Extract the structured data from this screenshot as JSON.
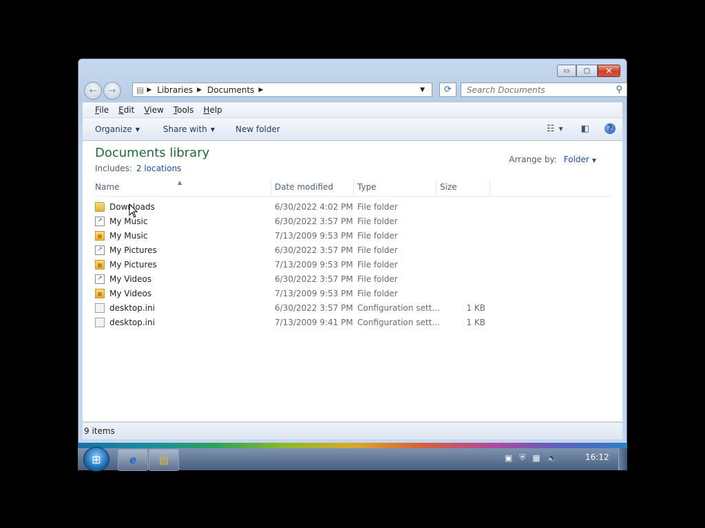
{
  "window": {
    "caption_buttons": {
      "minimize": "▭",
      "maximize": "▢",
      "close": "✕"
    }
  },
  "nav": {
    "back_icon": "←",
    "forward_icon": "→",
    "breadcrumbs": [
      "Libraries",
      "Documents"
    ],
    "refresh_icon": "⟳",
    "search_placeholder": "Search Documents",
    "search_icon": "⚲"
  },
  "menubar": [
    "File",
    "Edit",
    "View",
    "Tools",
    "Help"
  ],
  "commandbar": {
    "organize": "Organize",
    "share_with": "Share with",
    "new_folder": "New folder",
    "help_icon": "?"
  },
  "library": {
    "title": "Documents library",
    "includes_label": "Includes:",
    "includes_link": "2 locations",
    "arrange_label": "Arrange by:",
    "arrange_value": "Folder"
  },
  "columns": [
    "Name",
    "Date modified",
    "Type",
    "Size"
  ],
  "files": [
    {
      "name": "Downloads",
      "date": "6/30/2022 4:02 PM",
      "type": "File folder",
      "size": "",
      "icon": "folder-icon"
    },
    {
      "name": "My Music",
      "date": "6/30/2022 3:57 PM",
      "type": "File folder",
      "size": "",
      "icon": "shortcut-folder-icon"
    },
    {
      "name": "My Music",
      "date": "7/13/2009 9:53 PM",
      "type": "File folder",
      "size": "",
      "icon": "locked-folder-icon"
    },
    {
      "name": "My Pictures",
      "date": "6/30/2022 3:57 PM",
      "type": "File folder",
      "size": "",
      "icon": "shortcut-folder-icon"
    },
    {
      "name": "My Pictures",
      "date": "7/13/2009 9:53 PM",
      "type": "File folder",
      "size": "",
      "icon": "locked-folder-icon"
    },
    {
      "name": "My Videos",
      "date": "6/30/2022 3:57 PM",
      "type": "File folder",
      "size": "",
      "icon": "shortcut-folder-icon"
    },
    {
      "name": "My Videos",
      "date": "7/13/2009 9:53 PM",
      "type": "File folder",
      "size": "",
      "icon": "locked-folder-icon"
    },
    {
      "name": "desktop.ini",
      "date": "6/30/2022 3:57 PM",
      "type": "Configuration sett...",
      "size": "1 KB",
      "icon": "config-file-icon"
    },
    {
      "name": "desktop.ini",
      "date": "7/13/2009 9:41 PM",
      "type": "Configuration sett...",
      "size": "1 KB",
      "icon": "config-file-icon"
    }
  ],
  "status": {
    "count": "9 items"
  },
  "taskbar": {
    "start_icon": "⊞",
    "ie_icon": "e",
    "explorer_icon": "▤",
    "clock": "16:12"
  }
}
